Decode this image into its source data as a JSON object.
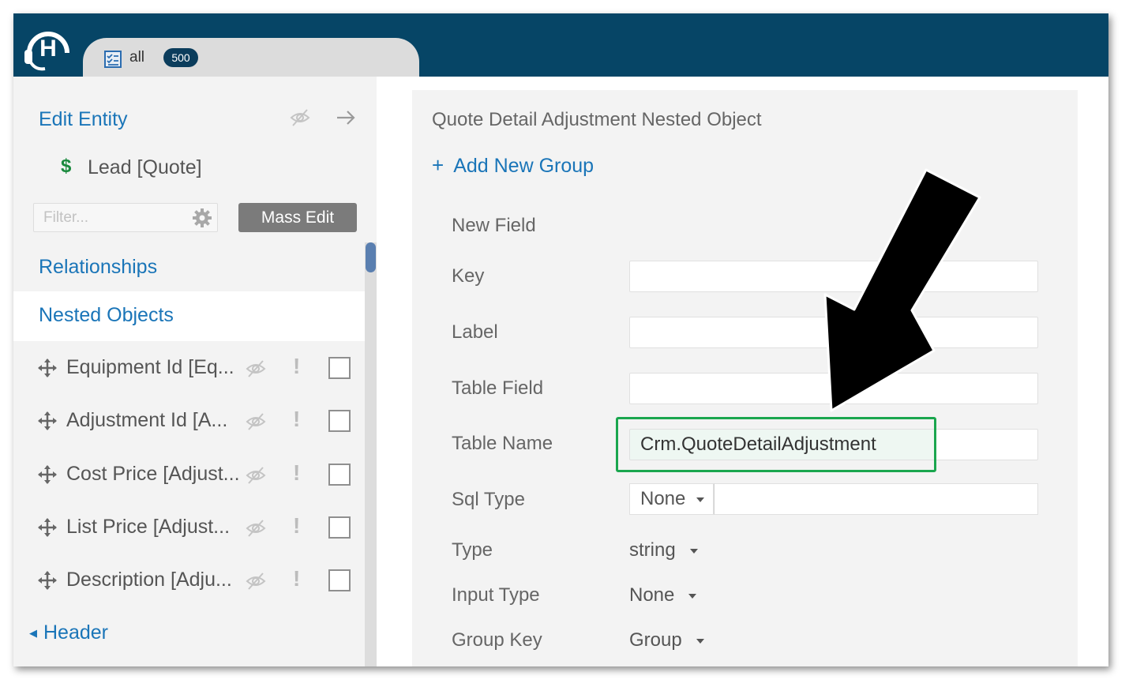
{
  "topbar": {
    "tab": {
      "label": "all",
      "badge": "500",
      "icon": "checklist-icon"
    }
  },
  "left": {
    "title": "Edit Entity",
    "entity": {
      "icon_symbol": "$",
      "name": "Lead [Quote]"
    },
    "filter": {
      "placeholder": "Filter...",
      "value": ""
    },
    "mass_edit_label": "Mass Edit",
    "relationships_label": "Relationships",
    "nested_objects_label": "Nested Objects",
    "fields": [
      {
        "label": "Equipment Id [Eq...",
        "required": "!"
      },
      {
        "label": "Adjustment Id [A...",
        "required": "!"
      },
      {
        "label": "Cost Price [Adjust...",
        "required": "!"
      },
      {
        "label": "List Price [Adjust...",
        "required": "!"
      },
      {
        "label": "Description [Adju...",
        "required": "!"
      }
    ],
    "header_toggle": {
      "caret": "◀",
      "label": "Header"
    }
  },
  "right": {
    "title": "Quote Detail Adjustment Nested Object",
    "add_group": {
      "plus": "+",
      "label": "Add New Group"
    },
    "new_field_label": "New Field",
    "key": {
      "label": "Key",
      "value": ""
    },
    "label_field": {
      "label": "Label",
      "value": ""
    },
    "table_field": {
      "label": "Table Field",
      "value": ""
    },
    "table_name": {
      "label": "Table Name",
      "value": "Crm.QuoteDetailAdjustment"
    },
    "sql_type": {
      "label": "Sql Type",
      "value": "None",
      "extra_value": ""
    },
    "type": {
      "label": "Type",
      "value": "string"
    },
    "input_type": {
      "label": "Input Type",
      "value": "None"
    },
    "group_key": {
      "label": "Group Key",
      "value": "Group"
    }
  },
  "colors": {
    "topbar": "#064566",
    "link": "#1a75b8",
    "highlight": "#1aa64e",
    "badge": "#0b3d5c"
  }
}
